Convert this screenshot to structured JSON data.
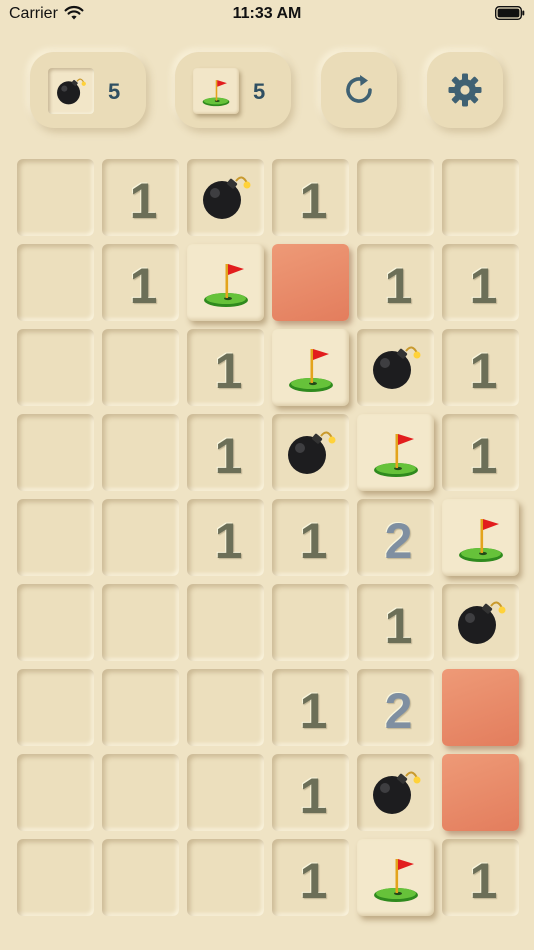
{
  "status_bar": {
    "carrier": "Carrier",
    "time": "11:33 AM"
  },
  "toolbar": {
    "bomb_count": "5",
    "flag_count": "5",
    "restart_icon": "restart-icon",
    "settings_icon": "gear-icon"
  },
  "board": {
    "columns": 6,
    "rows": 9,
    "cells": [
      [
        "",
        "1",
        "B",
        "1",
        "",
        ""
      ],
      [
        "",
        "1",
        "F",
        "R",
        "1",
        "1"
      ],
      [
        "",
        "",
        "1",
        "F",
        "B",
        "1"
      ],
      [
        "",
        "",
        "1",
        "B",
        "F",
        "1"
      ],
      [
        "",
        "",
        "1",
        "1",
        "2",
        "F"
      ],
      [
        "",
        "",
        "",
        "",
        "1",
        "B"
      ],
      [
        "",
        "",
        "",
        "1",
        "2",
        "R"
      ],
      [
        "",
        "",
        "",
        "1",
        "B",
        "R"
      ],
      [
        "",
        "",
        "",
        "1",
        "F",
        "1"
      ]
    ],
    "legend": {
      "B": "bomb",
      "F": "flag",
      "R": "red-cell"
    },
    "colors": {
      "number": "#6c6f58",
      "number_2": "#7f8fa1",
      "red_cell": "#e88a68",
      "background": "#efe3c4"
    }
  }
}
